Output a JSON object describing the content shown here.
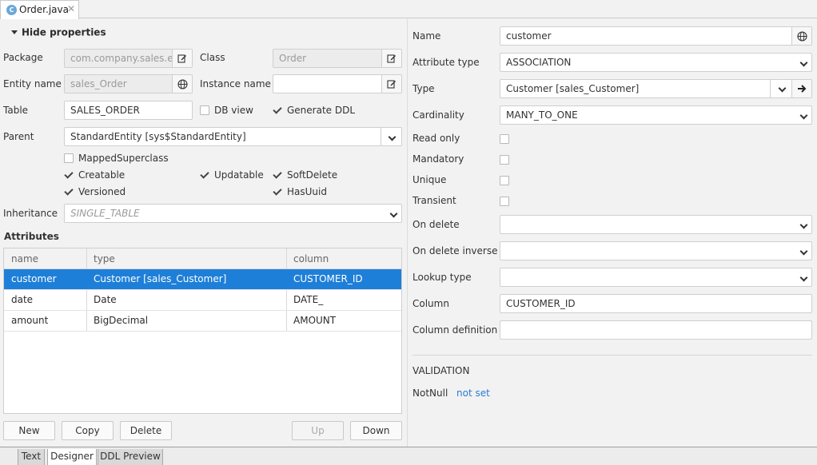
{
  "editor_tab": {
    "icon": "C",
    "title": "Order.java",
    "close": "✕"
  },
  "left": {
    "hide_properties": "Hide properties",
    "package_label": "Package",
    "package_value": "com.company.sales.e",
    "class_label": "Class",
    "class_value": "Order",
    "entity_name_label": "Entity name",
    "entity_name_value": "sales_Order",
    "instance_name_label": "Instance name",
    "instance_name_value": "",
    "table_label": "Table",
    "table_value": "SALES_ORDER",
    "db_view_label": "DB view",
    "db_view_checked": false,
    "generate_ddl_label": "Generate DDL",
    "generate_ddl_checked": true,
    "parent_label": "Parent",
    "parent_value": "StandardEntity [sys$StandardEntity]",
    "mapped_superclass": "MappedSuperclass",
    "creatable": "Creatable",
    "updatable": "Updatable",
    "soft_delete": "SoftDelete",
    "versioned": "Versioned",
    "has_uuid": "HasUuid",
    "inheritance_label": "Inheritance",
    "inheritance_value": "SINGLE_TABLE",
    "attributes_title": "Attributes",
    "columns": [
      "name",
      "type",
      "column"
    ],
    "rows": [
      {
        "name": "customer",
        "type": "Customer [sales_Customer]",
        "column": "CUSTOMER_ID",
        "selected": true
      },
      {
        "name": "date",
        "type": "Date",
        "column": "DATE_",
        "selected": false
      },
      {
        "name": "amount",
        "type": "BigDecimal",
        "column": "AMOUNT",
        "selected": false
      }
    ],
    "buttons": {
      "new": "New",
      "copy": "Copy",
      "delete": "Delete",
      "up": "Up",
      "down": "Down"
    }
  },
  "right": {
    "name_label": "Name",
    "name_value": "customer",
    "attribute_type_label": "Attribute type",
    "attribute_type_value": "ASSOCIATION",
    "type_label": "Type",
    "type_value": "Customer [sales_Customer]",
    "cardinality_label": "Cardinality",
    "cardinality_value": "MANY_TO_ONE",
    "read_only_label": "Read only",
    "mandatory_label": "Mandatory",
    "unique_label": "Unique",
    "transient_label": "Transient",
    "on_delete_label": "On delete",
    "on_delete_inverse_label": "On delete inverse",
    "lookup_type_label": "Lookup type",
    "column_label": "Column",
    "column_value": "CUSTOMER_ID",
    "column_definition_label": "Column definition",
    "validation_title": "VALIDATION",
    "notnull_label": "NotNull",
    "notnull_link": "not set"
  },
  "bottom_tabs": [
    "Text",
    "Designer",
    "DDL Preview"
  ],
  "colors": {
    "selection": "#1e7fd8",
    "link": "#2a7bd3",
    "accent_icon": "#6aa8d8"
  }
}
